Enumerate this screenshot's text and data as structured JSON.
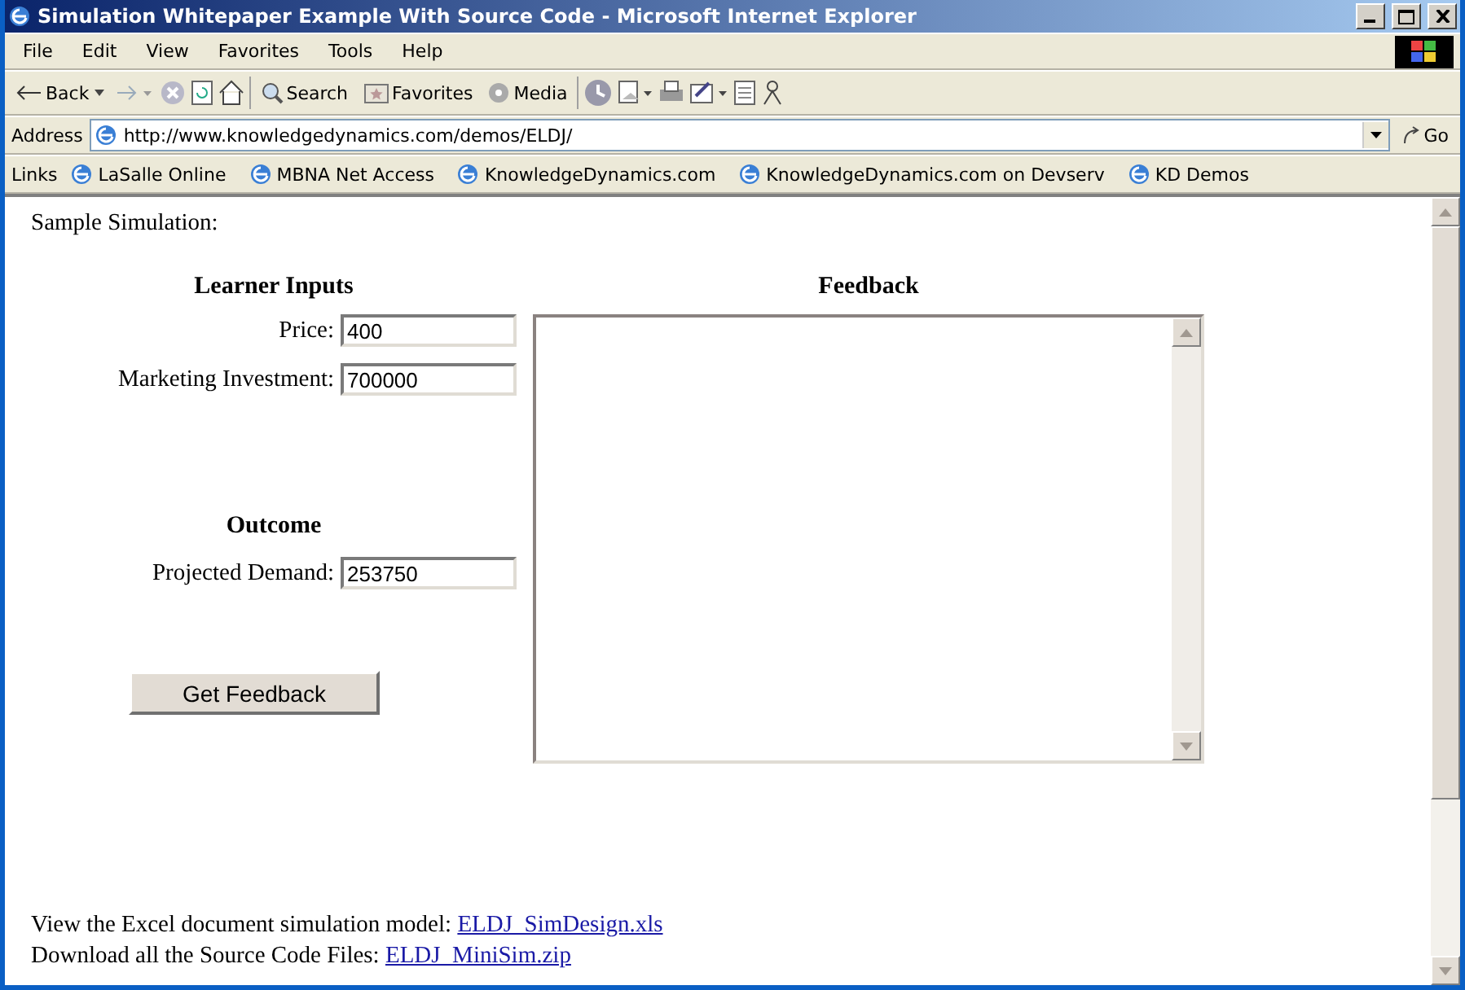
{
  "window": {
    "title": "Simulation Whitepaper Example With Source Code - Microsoft Internet Explorer"
  },
  "menu": [
    "File",
    "Edit",
    "View",
    "Favorites",
    "Tools",
    "Help"
  ],
  "toolbar": [
    {
      "kind": "back",
      "label": "Back"
    },
    {
      "kind": "forward"
    },
    {
      "kind": "stop"
    },
    {
      "kind": "refresh"
    },
    {
      "kind": "home"
    },
    {
      "kind": "search",
      "label": "Search"
    },
    {
      "kind": "favorites",
      "label": "Favorites"
    },
    {
      "kind": "media",
      "label": "Media"
    },
    {
      "kind": "history"
    },
    {
      "kind": "mail"
    },
    {
      "kind": "print"
    },
    {
      "kind": "edit"
    },
    {
      "kind": "discuss"
    },
    {
      "kind": "messenger"
    }
  ],
  "address": {
    "label": "Address",
    "value": "http://www.knowledgedynamics.com/demos/ELDJ/",
    "go": "Go"
  },
  "links": {
    "label": "Links",
    "items": [
      "LaSalle Online",
      "MBNA Net Access",
      "KnowledgeDynamics.com",
      "KnowledgeDynamics.com on Devserv",
      "KD Demos"
    ]
  },
  "page": {
    "intro": "Sample Simulation:",
    "inputs_heading": "Learner Inputs",
    "inputs": [
      {
        "label": "Price:",
        "value": "400"
      },
      {
        "label": "Marketing Investment:",
        "value": "700000"
      }
    ],
    "outcome_heading": "Outcome",
    "outcome": [
      {
        "label": "Projected Demand:",
        "value": "253750"
      }
    ],
    "button": "Get Feedback",
    "feedback_heading": "Feedback",
    "footer": [
      {
        "text": "View the Excel document simulation model: ",
        "link": "ELDJ_SimDesign.xls"
      },
      {
        "text": "Download all the Source Code Files: ",
        "link": "ELDJ_MiniSim.zip"
      }
    ]
  }
}
